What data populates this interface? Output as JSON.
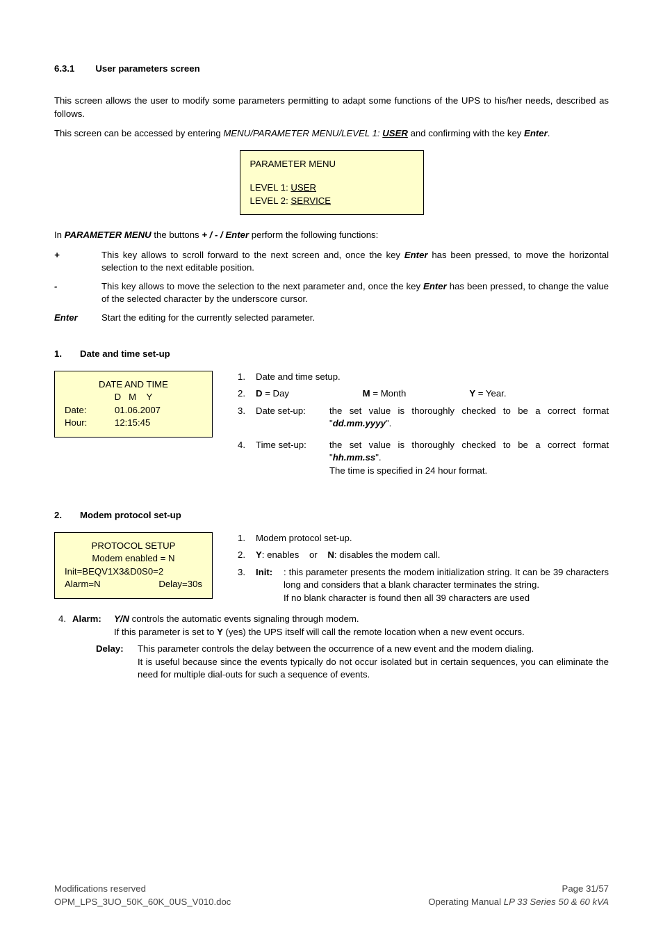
{
  "heading": {
    "number": "6.3.1",
    "title": "User parameters screen"
  },
  "intro1": "This screen allows the user to modify some parameters permitting to adapt some functions of the UPS to his/her needs, described as follows.",
  "intro2_pre": "This screen can be accessed by entering ",
  "intro2_path": "MENU/PARAMETER MENU/LEVEL 1: ",
  "intro2_user": "USER",
  "intro2_post": " and confirming with the key ",
  "intro2_enter": "Enter",
  "intro2_end": ".",
  "box1": {
    "title": "PARAMETER MENU",
    "l1a": "LEVEL 1: ",
    "l1b": "USER",
    "l2a": "LEVEL 2: ",
    "l2b": "SERVICE"
  },
  "pm_sentence_pre": "In ",
  "pm_sentence_pm": "PARAMETER MENU",
  "pm_sentence_mid": " the buttons ",
  "pm_sentence_btns": "+ / - / Enter",
  "pm_sentence_post": " perform the following functions:",
  "keys": {
    "plus": {
      "key": "+",
      "txt_pre": "This key allows to scroll forward to the next screen and, once the key ",
      "txt_enter": "Enter",
      "txt_post": " has been pressed, to move the horizontal selection to the next editable position."
    },
    "minus": {
      "key": "-",
      "txt_pre": "This key allows to move the selection to the next parameter and, once the key ",
      "txt_enter": "Enter",
      "txt_post": " has been pressed, to change the value of the selected character by the underscore cursor."
    },
    "enter": {
      "key": "Enter",
      "txt": "Start the editing for the currently selected parameter."
    }
  },
  "sec1": {
    "num": "1.",
    "title": "Date and time set-up",
    "box": {
      "title": "DATE AND TIME",
      "dmy": "D   M    Y",
      "date_lbl": "Date:",
      "date_val": "01.06.2007",
      "hour_lbl": "Hour:",
      "hour_val": "12:15:45"
    },
    "i1": {
      "n": "1.",
      "txt": "Date and time setup."
    },
    "i2": {
      "n": "2.",
      "d": "D",
      "deq": " = Day",
      "m": "M",
      "meq": " = Month",
      "y": "Y",
      "yeq": " = Year."
    },
    "i3": {
      "n": "3.",
      "lbl": "Date set-up:",
      "txt": "the set value is thoroughly checked to be a correct format \"",
      "fmt": "dd.mm.yyyy",
      "end": "\"."
    },
    "i4": {
      "n": "4.",
      "lbl": "Time set-up:",
      "txt": "the set value is thoroughly checked to be a correct format \"",
      "fmt": "hh.mm.ss",
      "end": "\".",
      "extra": "The time is specified in 24 hour format."
    }
  },
  "sec2": {
    "num": "2.",
    "title": "Modem protocol set-up",
    "box": {
      "title": "PROTOCOL SETUP",
      "l1": "Modem enabled = N",
      "l2": "Init=BEQV1X3&D0S0=2",
      "l3a": "Alarm=N",
      "l3b": "Delay=30s"
    },
    "i1": {
      "n": "1.",
      "txt": "Modem protocol set-up."
    },
    "i2": {
      "n": "2.",
      "y": "Y",
      "ytxt": ": enables    or    ",
      "nlet": "N",
      "ntxt": ": disables the modem call."
    },
    "i3": {
      "n": "3.",
      "lbl": "Init",
      "txt": ": this parameter presents the modem initialization string. It can be 39 characters long and considers that a blank character terminates the string.",
      "extra": "If no blank character is found then all 39 characters are used"
    },
    "i4": {
      "n": "4.",
      "alarm_lbl": "Alarm",
      "alarm_col": ":",
      "alarm_yn": "Y/N",
      "alarm_txt1": " controls the automatic events signaling through modem.",
      "alarm_txt2a": "If this parameter is set to ",
      "alarm_txt2y": "Y",
      "alarm_txt2b": " (yes) the UPS itself will call the remote location when a new event occurs.",
      "delay_lbl": "Delay",
      "delay_col": ":",
      "delay_txt1": "This parameter controls the delay between the occurrence of a new event and the modem dialing.",
      "delay_txt2": "It is useful because since the events typically do not occur isolated but in certain sequences, you can eliminate the need for multiple dial-outs for such a sequence of events."
    }
  },
  "footer": {
    "l1": "Modifications reserved",
    "l2": "OPM_LPS_3UO_50K_60K_0US_V010.doc",
    "r1": "Page 31/57",
    "r2_pre": "Operating Manual ",
    "r2_it": "LP 33 Series 50 & 60 kVA"
  }
}
